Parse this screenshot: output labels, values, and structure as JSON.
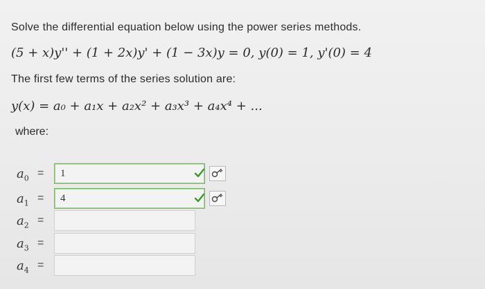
{
  "question": {
    "prompt": "Solve the differential equation below using the power series methods.",
    "equation": "(5 + x)y'' + (1 + 2x)y' + (1 − 3x)y = 0,  y(0) = 1,  y'(0) = 4",
    "subtitle": "The first few terms of the series solution are:",
    "series": "y(x) = a₀ + a₁x + a₂x² + a₃x³ + a₄x⁴ + ...",
    "where_label": "where:"
  },
  "coefficients": [
    {
      "label": "a",
      "sub": "0",
      "eq": "=",
      "value": "1",
      "status": "correct"
    },
    {
      "label": "a",
      "sub": "1",
      "eq": "=",
      "value": "4",
      "status": "correct"
    },
    {
      "label": "a",
      "sub": "2",
      "eq": "=",
      "value": "",
      "status": "empty"
    },
    {
      "label": "a",
      "sub": "3",
      "eq": "=",
      "value": "",
      "status": "empty"
    },
    {
      "label": "a",
      "sub": "4",
      "eq": "=",
      "value": "",
      "status": "empty"
    }
  ],
  "icons": {
    "check": "check-icon",
    "key": "key-icon"
  },
  "colors": {
    "correct_border": "#7fb26a",
    "check": "#3a9a2a"
  }
}
